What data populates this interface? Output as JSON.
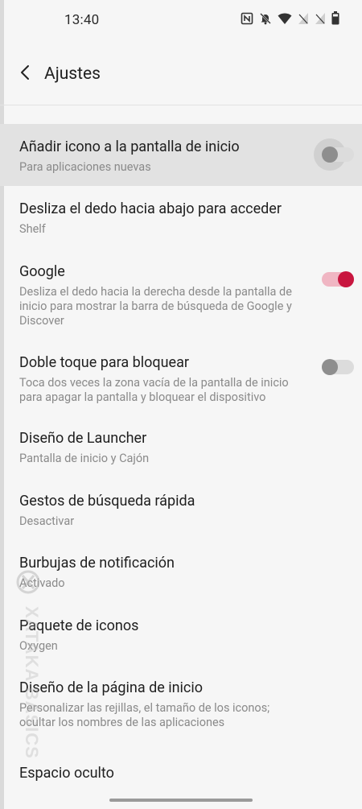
{
  "status_bar": {
    "time": "13:40",
    "icons": [
      "nfc-icon",
      "bell-off-icon",
      "wifi-icon",
      "sim-no-signal-icon",
      "sim2-no-signal-icon",
      "battery-icon"
    ]
  },
  "app_bar": {
    "title": "Ajustes",
    "back_icon": "chevron-left-icon"
  },
  "settings": [
    {
      "title": "Añadir icono a la pantalla de inicio",
      "subtitle": "Para aplicaciones nuevas",
      "toggle": "off",
      "highlighted": true
    },
    {
      "title": "Desliza el dedo hacia abajo para acceder",
      "subtitle": "Shelf"
    },
    {
      "title": "Google",
      "subtitle": "Desliza el dedo hacia la derecha desde la pantalla de inicio para mostrar la barra de búsqueda de Google y Discover",
      "toggle": "on"
    },
    {
      "title": "Doble toque para bloquear",
      "subtitle": "Toca dos veces la zona vacía de la pantalla de inicio para apagar la pantalla y bloquear el dispositivo",
      "toggle": "off"
    },
    {
      "title": "Diseño de Launcher",
      "subtitle": "Pantalla de inicio y Cajón"
    },
    {
      "title": "Gestos de búsqueda rápida",
      "subtitle": "Desactivar"
    },
    {
      "title": "Burbujas de notificación",
      "subtitle": "Activado"
    },
    {
      "title": "Paquete de iconos",
      "subtitle": "Oxygen"
    },
    {
      "title": "Diseño de la página de inicio",
      "subtitle": "Personalizar las rejillas, el tamaño de los iconos; ocultar los nombres de las aplicaciones"
    },
    {
      "title": "Espacio oculto",
      "subtitle": ""
    }
  ],
  "watermark": "XATAKA BASICS",
  "colors": {
    "background": "#f6f6f6",
    "accent": "#c8163f",
    "accent_track": "#f0b6c3",
    "highlight_row": "#e2e2e2",
    "subtitle": "#8a8a8a"
  }
}
